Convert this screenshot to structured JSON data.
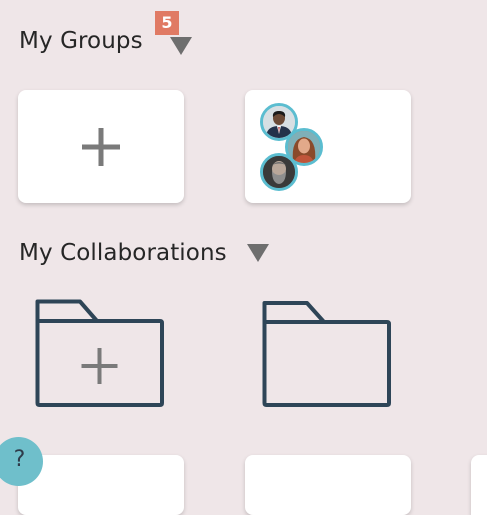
{
  "groups_section": {
    "title": "My Groups",
    "badge_count": "5",
    "caret_icon": "caret-down-icon",
    "add_card_icon": "plus-icon",
    "group_avatars": [
      "man-in-suit-avatar",
      "woman-avatar",
      "bearded-man-avatar"
    ]
  },
  "collaborations_section": {
    "title": "My Collaborations",
    "caret_icon": "caret-down-icon",
    "add_folder_icon": "folder-plus-icon",
    "folder_icon": "folder-icon"
  },
  "help": {
    "label": "?"
  },
  "colors": {
    "background": "#EFE6E8",
    "badge": "#E07A64",
    "avatar_ring": "#5BBDD0",
    "folder_stroke": "#2E4557",
    "plus": "#7a7a7a",
    "help_button": "#6FBFCB"
  }
}
